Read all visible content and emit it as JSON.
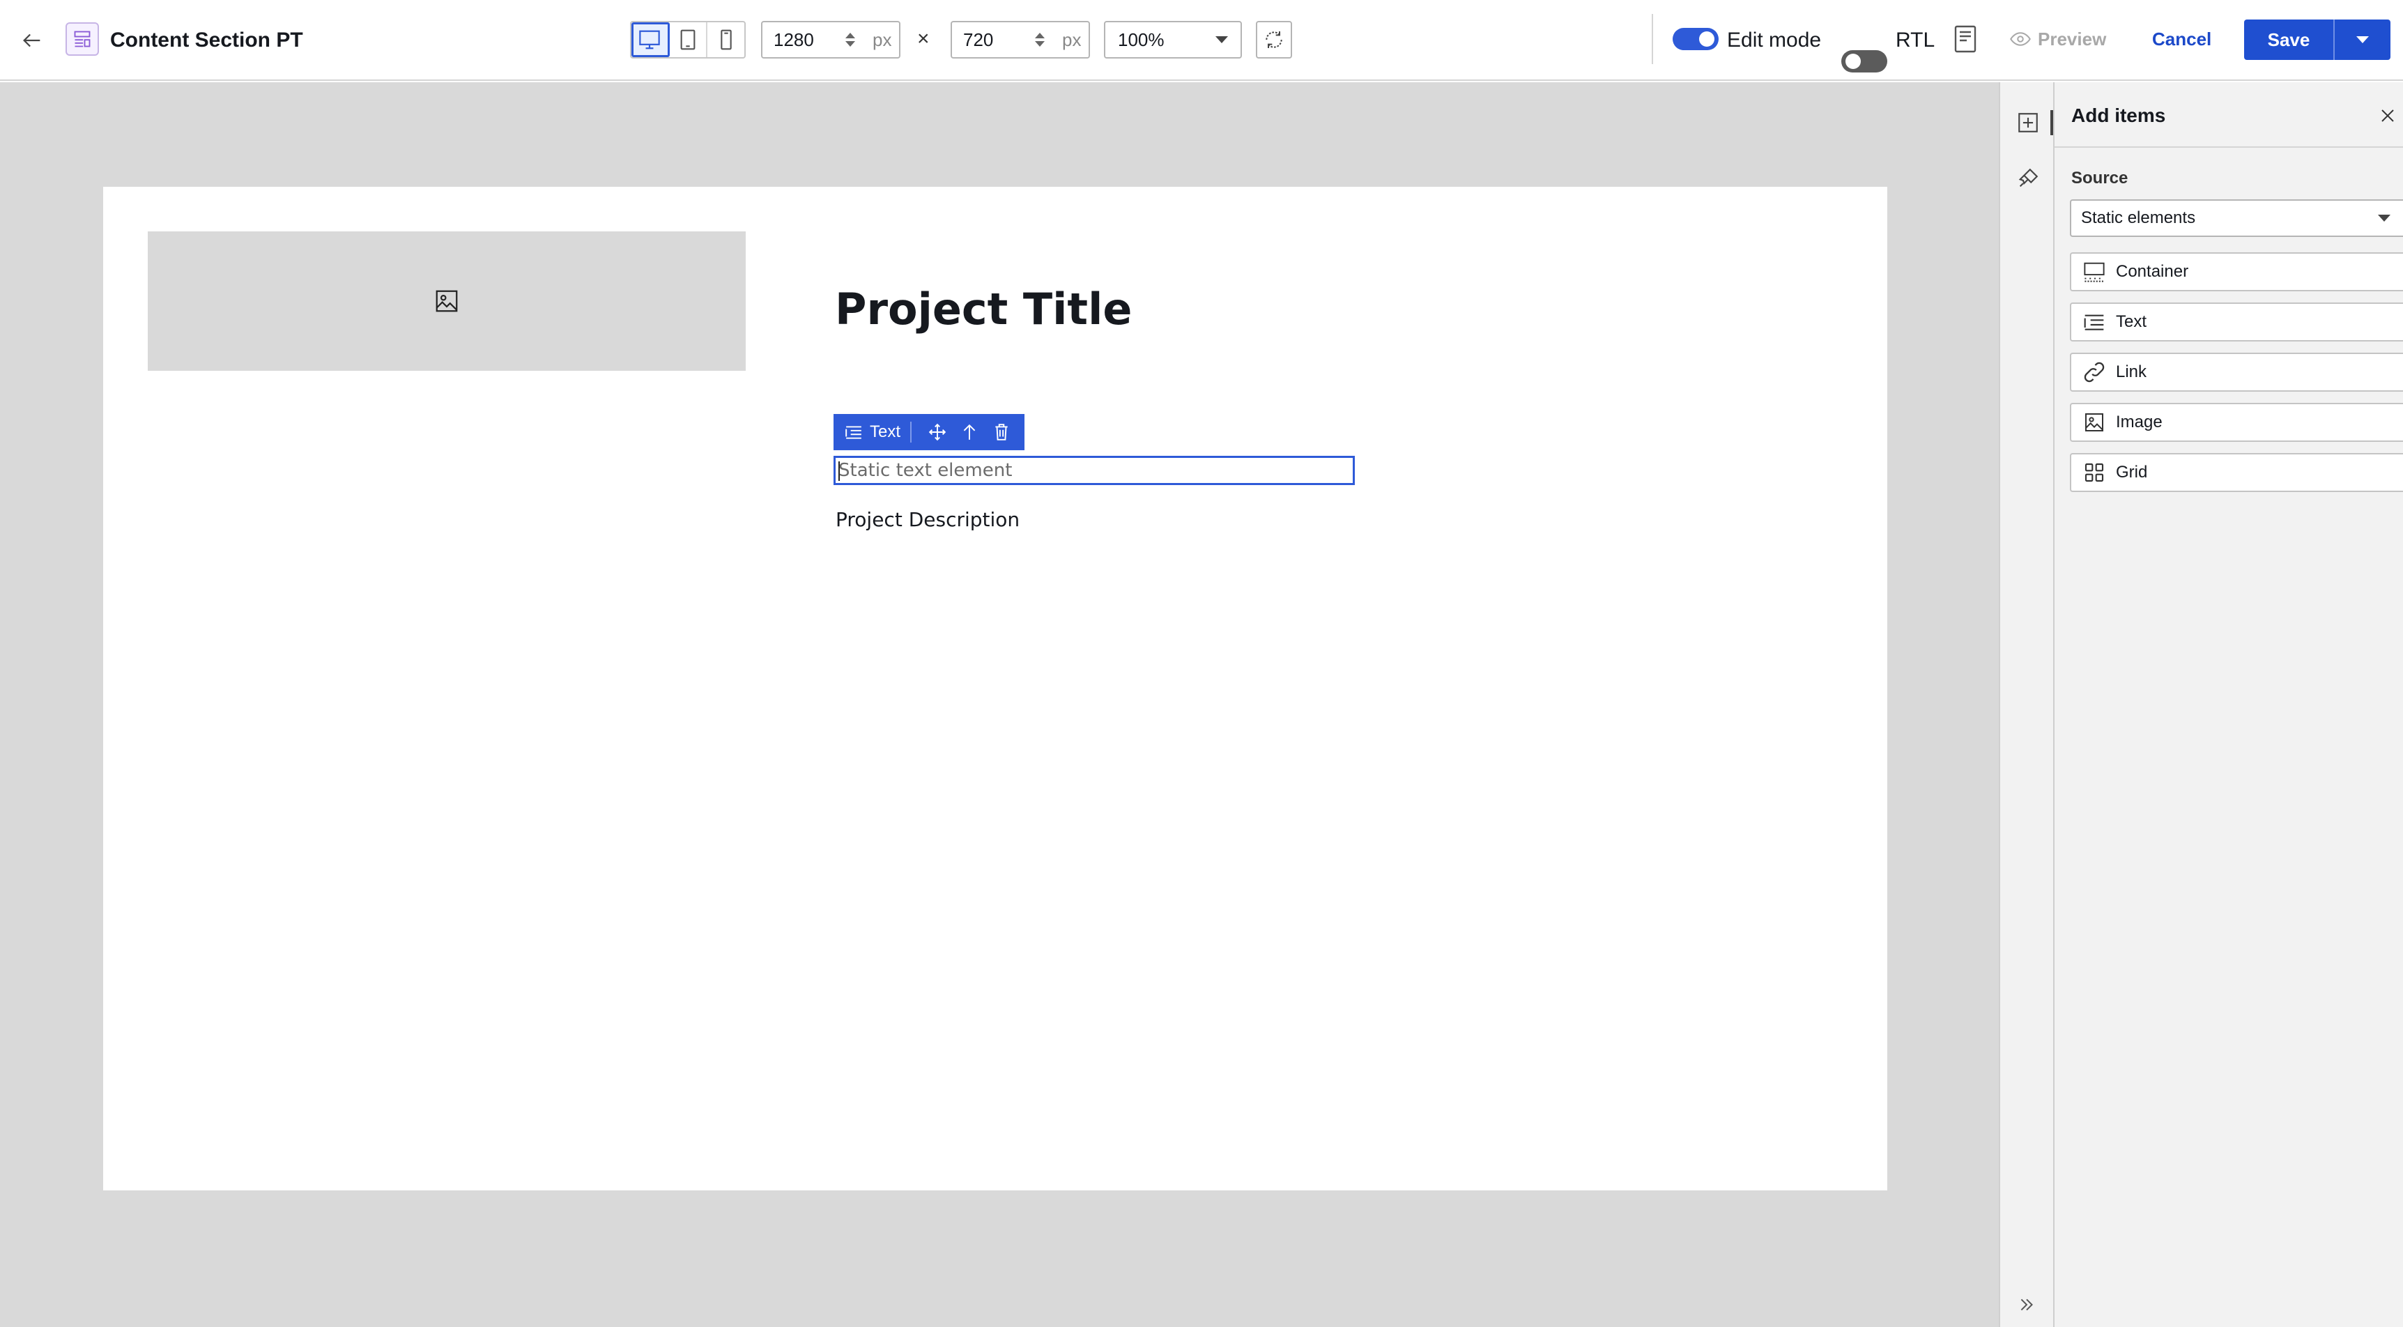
{
  "header": {
    "doc_title": "Content Section PT",
    "width_value": "1280",
    "height_value": "720",
    "unit": "px",
    "times_symbol": "×",
    "zoom_value": "100%",
    "edit_mode_label": "Edit mode",
    "edit_mode_on": true,
    "rtl_label": "RTL",
    "rtl_on": false,
    "preview_label": "Preview",
    "cancel_label": "Cancel",
    "save_label": "Save",
    "active_device": "desktop"
  },
  "canvas": {
    "project_title": "Project Title",
    "toolbar_label": "Text",
    "static_text": "Static text element",
    "project_description": "Project Description"
  },
  "panel": {
    "title": "Add items",
    "source_label": "Source",
    "source_value": "Static elements",
    "items": [
      {
        "label": "Container",
        "icon": "container-icon"
      },
      {
        "label": "Text",
        "icon": "text-icon"
      },
      {
        "label": "Link",
        "icon": "link-icon"
      },
      {
        "label": "Image",
        "icon": "image-icon"
      },
      {
        "label": "Grid",
        "icon": "grid-icon"
      }
    ]
  },
  "colors": {
    "accent": "#2e5ad8",
    "save_button": "#1f4fd0",
    "cancel_text": "#1c49c9",
    "canvas_bg": "#d9d9d9"
  }
}
